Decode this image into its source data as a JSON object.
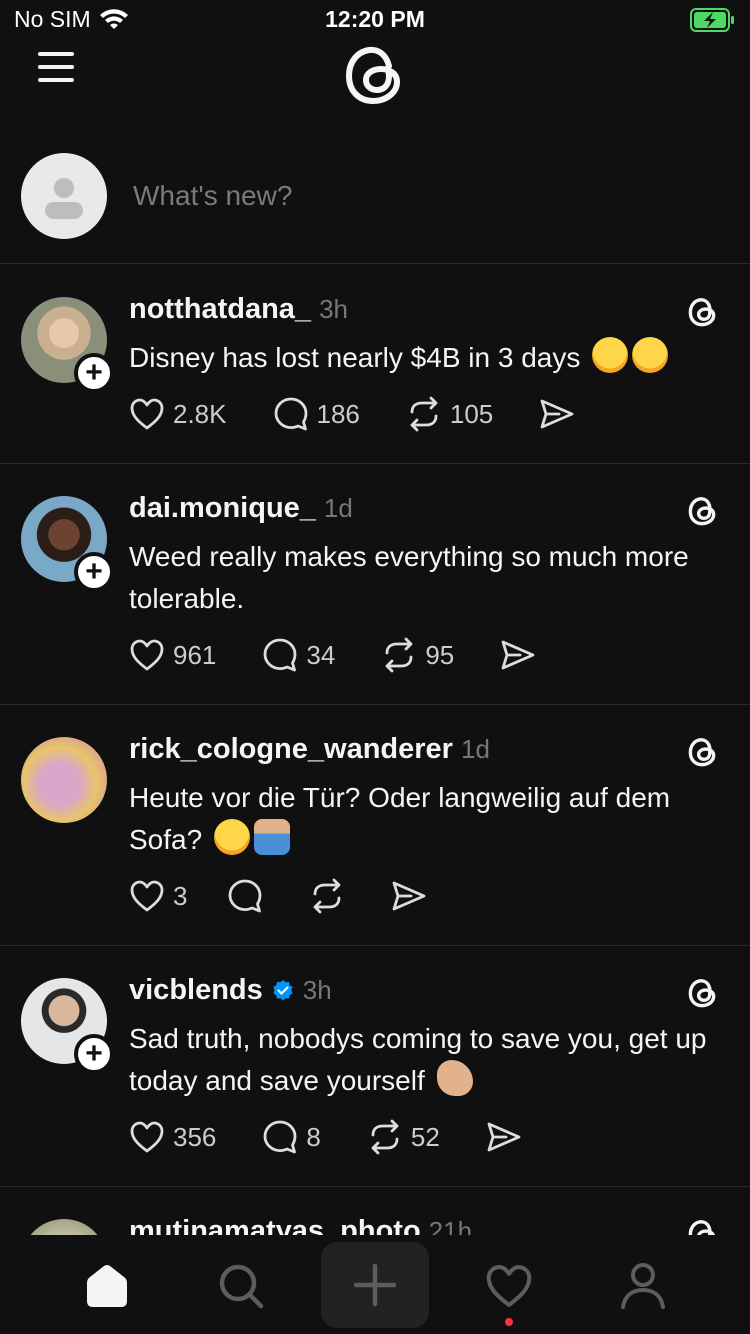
{
  "status_bar": {
    "carrier": "No SIM",
    "time": "12:20 PM"
  },
  "composer": {
    "placeholder": "What's new?"
  },
  "posts": [
    {
      "username": "notthatdana_",
      "time": "3h",
      "text": "Disney has lost nearly $4B in 3 days",
      "emojis": [
        "face-with-tears-of-joy",
        "face-with-tears-of-joy"
      ],
      "likes": "2.8K",
      "replies": "186",
      "reposts": "105",
      "verified": false,
      "show_follow": true
    },
    {
      "username": "dai.monique_",
      "time": "1d",
      "text": "Weed really makes everything so much more tolerable.",
      "likes": "961",
      "replies": "34",
      "reposts": "95",
      "verified": false,
      "show_follow": true
    },
    {
      "username": "rick_cologne_wanderer",
      "time": "1d",
      "text": "Heute vor die Tür? Oder langweilig auf dem Sofa?",
      "emojis": [
        "thinking-face",
        "person-shrugging"
      ],
      "likes": "3",
      "replies": "",
      "reposts": "",
      "verified": false,
      "show_follow": false
    },
    {
      "username": "vicblends",
      "time": "3h",
      "text": "Sad truth, nobodys coming to save you, get up today and save yourself",
      "emojis": [
        "flexed-biceps"
      ],
      "likes": "356",
      "replies": "8",
      "reposts": "52",
      "verified": true,
      "show_follow": true
    },
    {
      "username": "mutinamatyas_photo",
      "time": "21h"
    }
  ],
  "tab_bar": {
    "items": [
      "home-icon",
      "search-icon",
      "plus-icon",
      "heart-icon",
      "profile-icon"
    ],
    "active": "home-icon",
    "notification_dot_color": "#ff3040"
  },
  "colors": {
    "background": "#101010",
    "text": "#f3f5f7",
    "muted": "#777777",
    "verified_blue": "#0095f6"
  }
}
